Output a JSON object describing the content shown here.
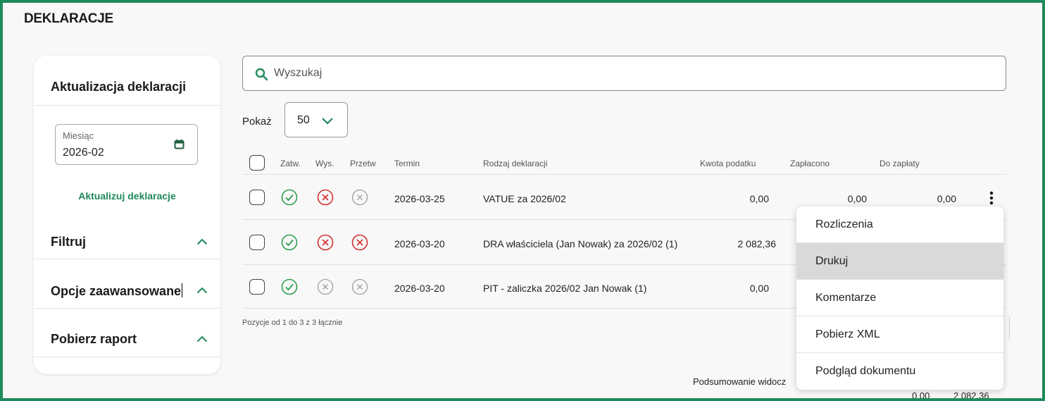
{
  "page": {
    "title": "DEKLARACJE"
  },
  "sidebar": {
    "heading": "Aktualizacja deklaracji",
    "month_label": "Miesiąc",
    "month_value": "2026-02",
    "update_link": "Aktualizuj deklaracje",
    "sections": [
      "Filtruj",
      "Opcje zaawansowane",
      "Pobierz raport"
    ]
  },
  "search": {
    "placeholder": "Wyszukaj"
  },
  "show": {
    "label": "Pokaż",
    "value": "50"
  },
  "table": {
    "headers": {
      "approved": "Zatw.",
      "sent": "Wys.",
      "processed": "Przetw",
      "deadline": "Termin",
      "type": "Rodzaj deklaracji",
      "tax_amount": "Kwota podatku",
      "paid": "Zapłacono",
      "to_pay": "Do zapłaty"
    },
    "rows": [
      {
        "approved": "ok",
        "sent": "error",
        "processed": "neutral",
        "deadline": "2026-03-25",
        "type": "VATUE za 2026/02",
        "tax_amount": "0,00",
        "paid": "0,00",
        "to_pay": "0,00"
      },
      {
        "approved": "ok",
        "sent": "error",
        "processed": "error",
        "deadline": "2026-03-20",
        "type": "DRA właściciela (Jan Nowak) za 2026/02 (1)",
        "tax_amount": "2 082,36"
      },
      {
        "approved": "ok",
        "sent": "neutral",
        "processed": "neutral",
        "deadline": "2026-03-20",
        "type": "PIT - zaliczka 2026/02 Jan Nowak (1)",
        "tax_amount": "0,00"
      }
    ],
    "footer": "Pozycje od 1 do 3 z 3 łącznie"
  },
  "summary": {
    "label": "Podsumowanie widocz",
    "values": [
      "0,00",
      "2 082,36"
    ]
  },
  "context_menu": {
    "items": [
      "Rozliczenia",
      "Drukuj",
      "Komentarze",
      "Pobierz XML",
      "Podgląd dokumentu"
    ],
    "active_index": 1
  },
  "colors": {
    "accent": "#1f8a5b",
    "ok": "#2e9e4f",
    "error": "#d32f2f",
    "neutral": "#9e9e9e"
  },
  "icons": {
    "search": "search-icon",
    "calendar": "calendar-icon",
    "chevron_up": "chevron-up-icon",
    "chevron_down": "chevron-down-icon",
    "kebab": "more-vertical-icon",
    "status_ok": "check-circle-icon",
    "status_error": "x-circle-icon",
    "status_neutral": "x-circle-gray-icon"
  }
}
